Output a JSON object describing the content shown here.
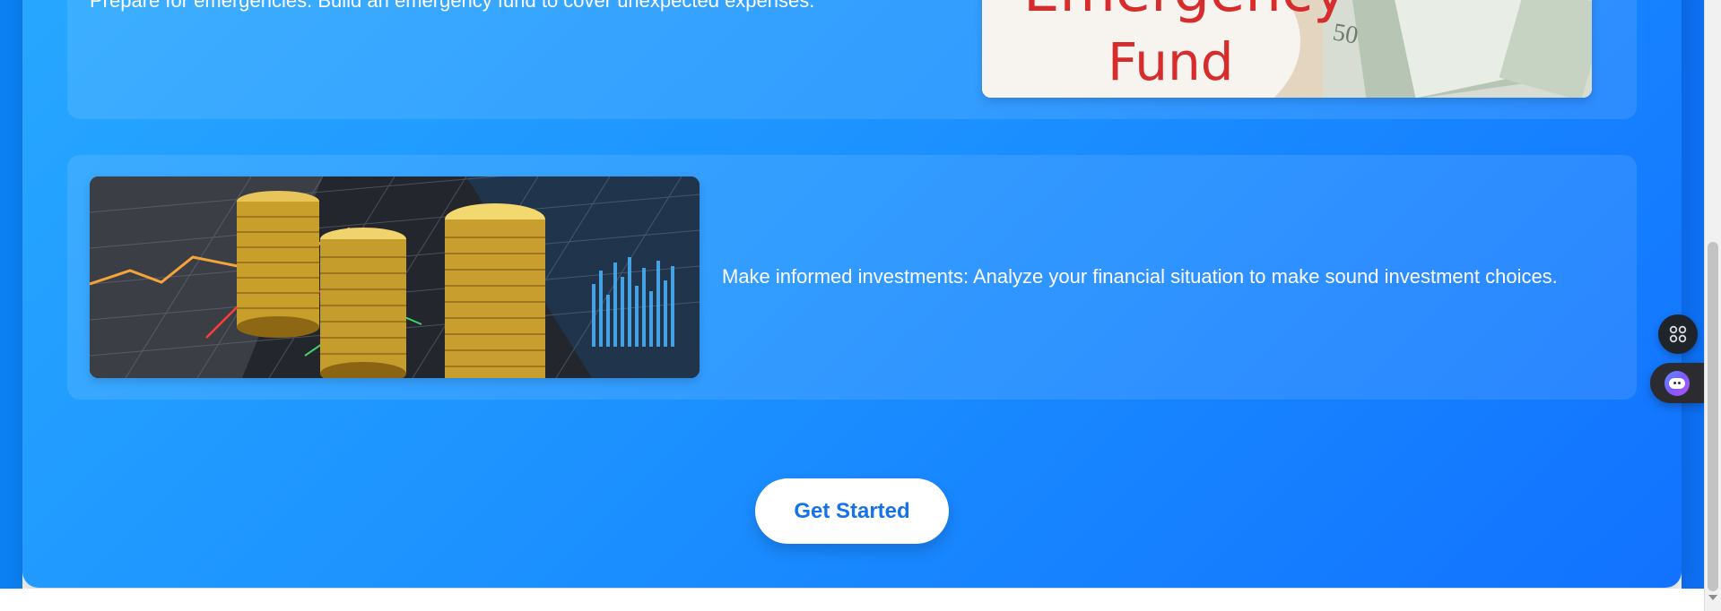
{
  "content": {
    "emergency_text": "Prepare for emergencies: Build an emergency fund to cover unexpected expenses.",
    "investment_text": "Make informed investments: Analyze your financial situation to make sound investment choices.",
    "emergency_image_text": {
      "line1": "Emergency",
      "line2": "Fund"
    }
  },
  "actions": {
    "cta_label": "Get Started"
  },
  "icons": {
    "floating_grid": "grid-icon",
    "floating_assistant": "assistant-icon"
  },
  "colors": {
    "panel_start": "#27a7ff",
    "panel_end": "#1172ff",
    "button_text": "#1572e8"
  }
}
